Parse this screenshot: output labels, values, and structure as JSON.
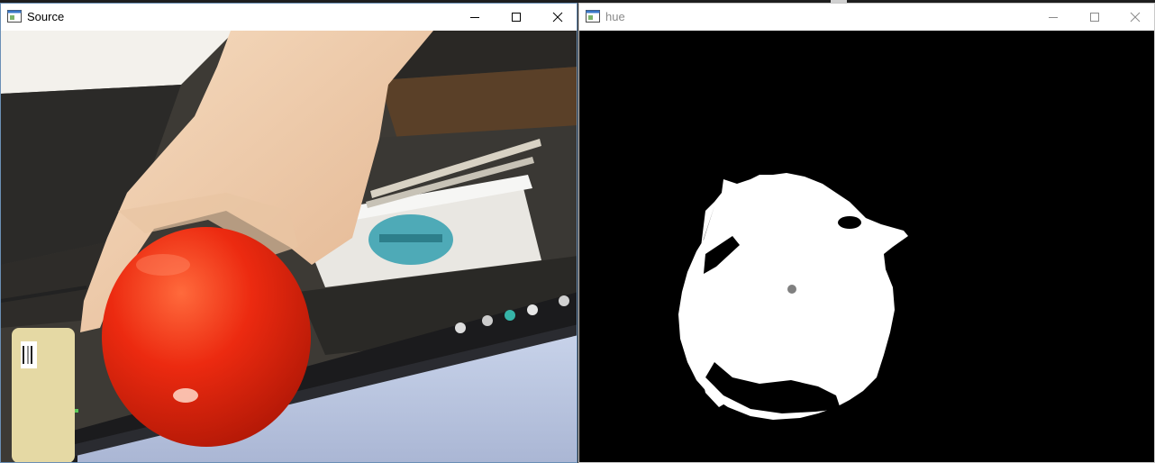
{
  "windows": {
    "source": {
      "title": "Source"
    },
    "hue": {
      "title": "hue"
    }
  },
  "icons": {
    "app": "window-app-icon",
    "minimize": "minimize-icon",
    "maximize": "maximize-icon",
    "close": "close-icon"
  },
  "colors": {
    "ball": "#e8290f",
    "mask_background": "#000000",
    "mask_foreground": "#ffffff",
    "centroid": "#808080"
  }
}
